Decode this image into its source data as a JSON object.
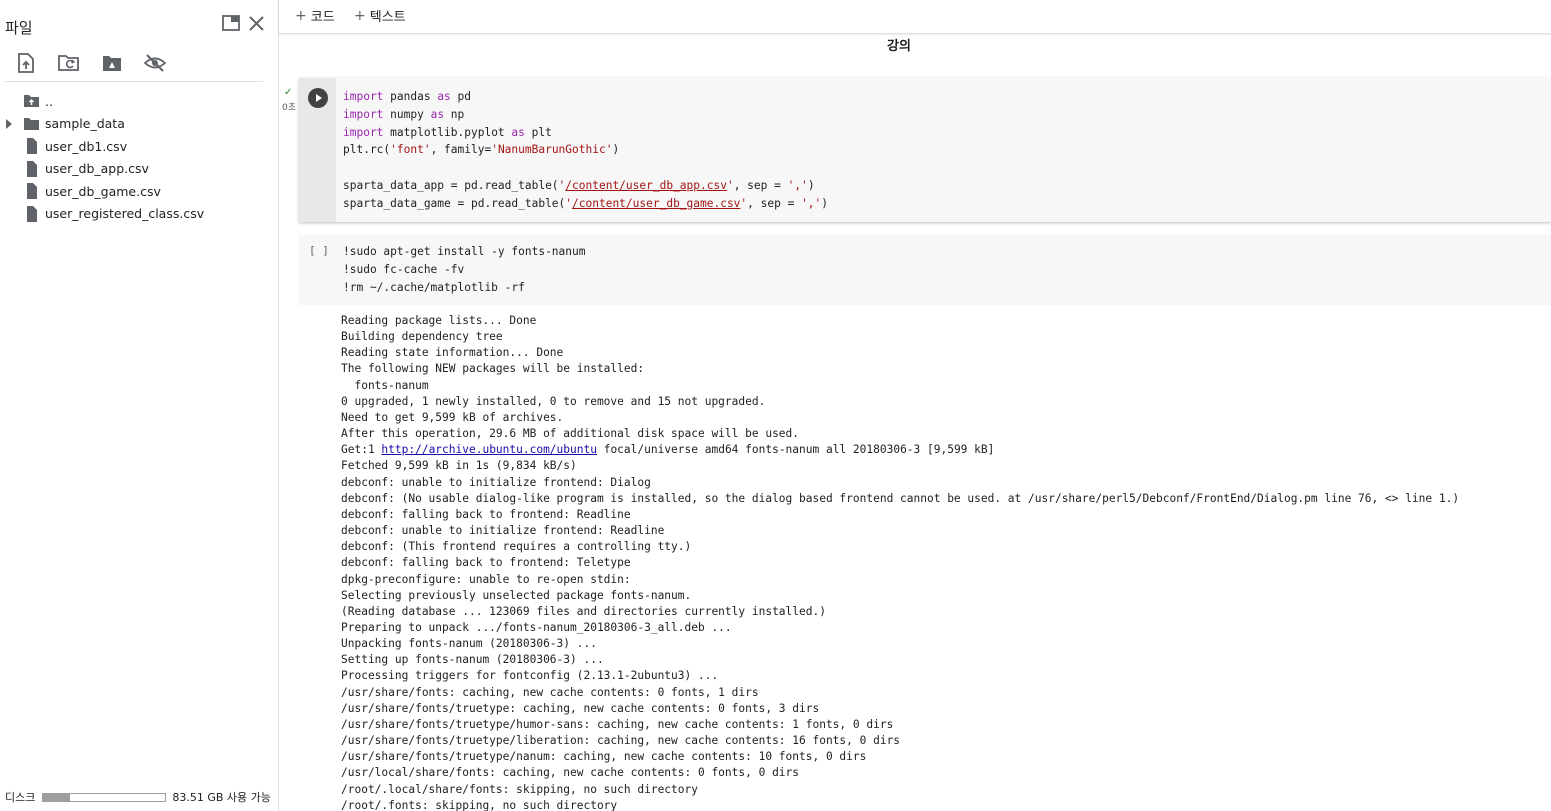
{
  "sidebar": {
    "title": "파일",
    "tools": [
      {
        "icon": "upload-file-icon"
      },
      {
        "icon": "refresh-folder-icon"
      },
      {
        "icon": "mount-drive-icon"
      },
      {
        "icon": "hide-files-icon"
      }
    ],
    "tree": [
      {
        "label": "..",
        "icon": "parent-folder-icon",
        "caret": false
      },
      {
        "label": "sample_data",
        "icon": "folder-icon",
        "caret": true
      },
      {
        "label": "user_db1.csv",
        "icon": "file-icon",
        "caret": false
      },
      {
        "label": "user_db_app.csv",
        "icon": "file-icon",
        "caret": false
      },
      {
        "label": "user_db_game.csv",
        "icon": "file-icon",
        "caret": false
      },
      {
        "label": "user_registered_class.csv",
        "icon": "file-icon",
        "caret": false
      }
    ],
    "disk": {
      "label": "디스크",
      "available": "83.51 GB 사용 가능",
      "used_fraction": 0.22
    }
  },
  "toolbar": {
    "add_code": "코드",
    "add_text": "텍스트"
  },
  "section_title": "강의",
  "cell1": {
    "status_check": "✓",
    "exec_time": "0초",
    "lines": {
      "l1": {
        "kw1": "import",
        "a": " pandas ",
        "kw2": "as",
        "b": " pd"
      },
      "l2": {
        "kw1": "import",
        "a": " numpy ",
        "kw2": "as",
        "b": " np"
      },
      "l3": {
        "kw1": "import",
        "a": " matplotlib.pyplot ",
        "kw2": "as",
        "b": " plt"
      },
      "l4": {
        "a": "plt.rc(",
        "s1": "'font'",
        "b": ", family=",
        "s2": "'NanumBarunGothic'",
        "c": ")"
      },
      "l6": {
        "a": "sparta_data_app = pd.read_table(",
        "q1": "'",
        "path": "/content/user_db_app.csv",
        "q2": "'",
        "b": ", sep = ",
        "s": "','",
        "c": ")"
      },
      "l7": {
        "a": "sparta_data_game = pd.read_table(",
        "q1": "'",
        "path": "/content/user_db_game.csv",
        "q2": "'",
        "b": ", sep = ",
        "s": "','",
        "c": ")"
      }
    }
  },
  "cell2": {
    "bracket": "[ ]",
    "lines": [
      "!sudo apt-get install -y fonts-nanum",
      "!sudo fc-cache -fv",
      "!rm ~/.cache/matplotlib -rf"
    ]
  },
  "output": {
    "lines_before": [
      "Reading package lists... Done",
      "Building dependency tree",
      "Reading state information... Done",
      "The following NEW packages will be installed:",
      "  fonts-nanum",
      "0 upgraded, 1 newly installed, 0 to remove and 15 not upgraded.",
      "Need to get 9,599 kB of archives.",
      "After this operation, 29.6 MB of additional disk space will be used."
    ],
    "get_prefix": "Get:1 ",
    "get_link": "http://archive.ubuntu.com/ubuntu",
    "get_suffix": " focal/universe amd64 fonts-nanum all 20180306-3 [9,599 kB]",
    "lines_after": [
      "Fetched 9,599 kB in 1s (9,834 kB/s)",
      "debconf: unable to initialize frontend: Dialog",
      "debconf: (No usable dialog-like program is installed, so the dialog based frontend cannot be used. at /usr/share/perl5/Debconf/FrontEnd/Dialog.pm line 76, <> line 1.)",
      "debconf: falling back to frontend: Readline",
      "debconf: unable to initialize frontend: Readline",
      "debconf: (This frontend requires a controlling tty.)",
      "debconf: falling back to frontend: Teletype",
      "dpkg-preconfigure: unable to re-open stdin:",
      "Selecting previously unselected package fonts-nanum.",
      "(Reading database ... 123069 files and directories currently installed.)",
      "Preparing to unpack .../fonts-nanum_20180306-3_all.deb ...",
      "Unpacking fonts-nanum (20180306-3) ...",
      "Setting up fonts-nanum (20180306-3) ...",
      "Processing triggers for fontconfig (2.13.1-2ubuntu3) ...",
      "/usr/share/fonts: caching, new cache contents: 0 fonts, 1 dirs",
      "/usr/share/fonts/truetype: caching, new cache contents: 0 fonts, 3 dirs",
      "/usr/share/fonts/truetype/humor-sans: caching, new cache contents: 1 fonts, 0 dirs",
      "/usr/share/fonts/truetype/liberation: caching, new cache contents: 16 fonts, 0 dirs",
      "/usr/share/fonts/truetype/nanum: caching, new cache contents: 10 fonts, 0 dirs",
      "/usr/local/share/fonts: caching, new cache contents: 0 fonts, 0 dirs",
      "/root/.local/share/fonts: skipping, no such directory",
      "/root/.fonts: skipping, no such directory"
    ]
  }
}
